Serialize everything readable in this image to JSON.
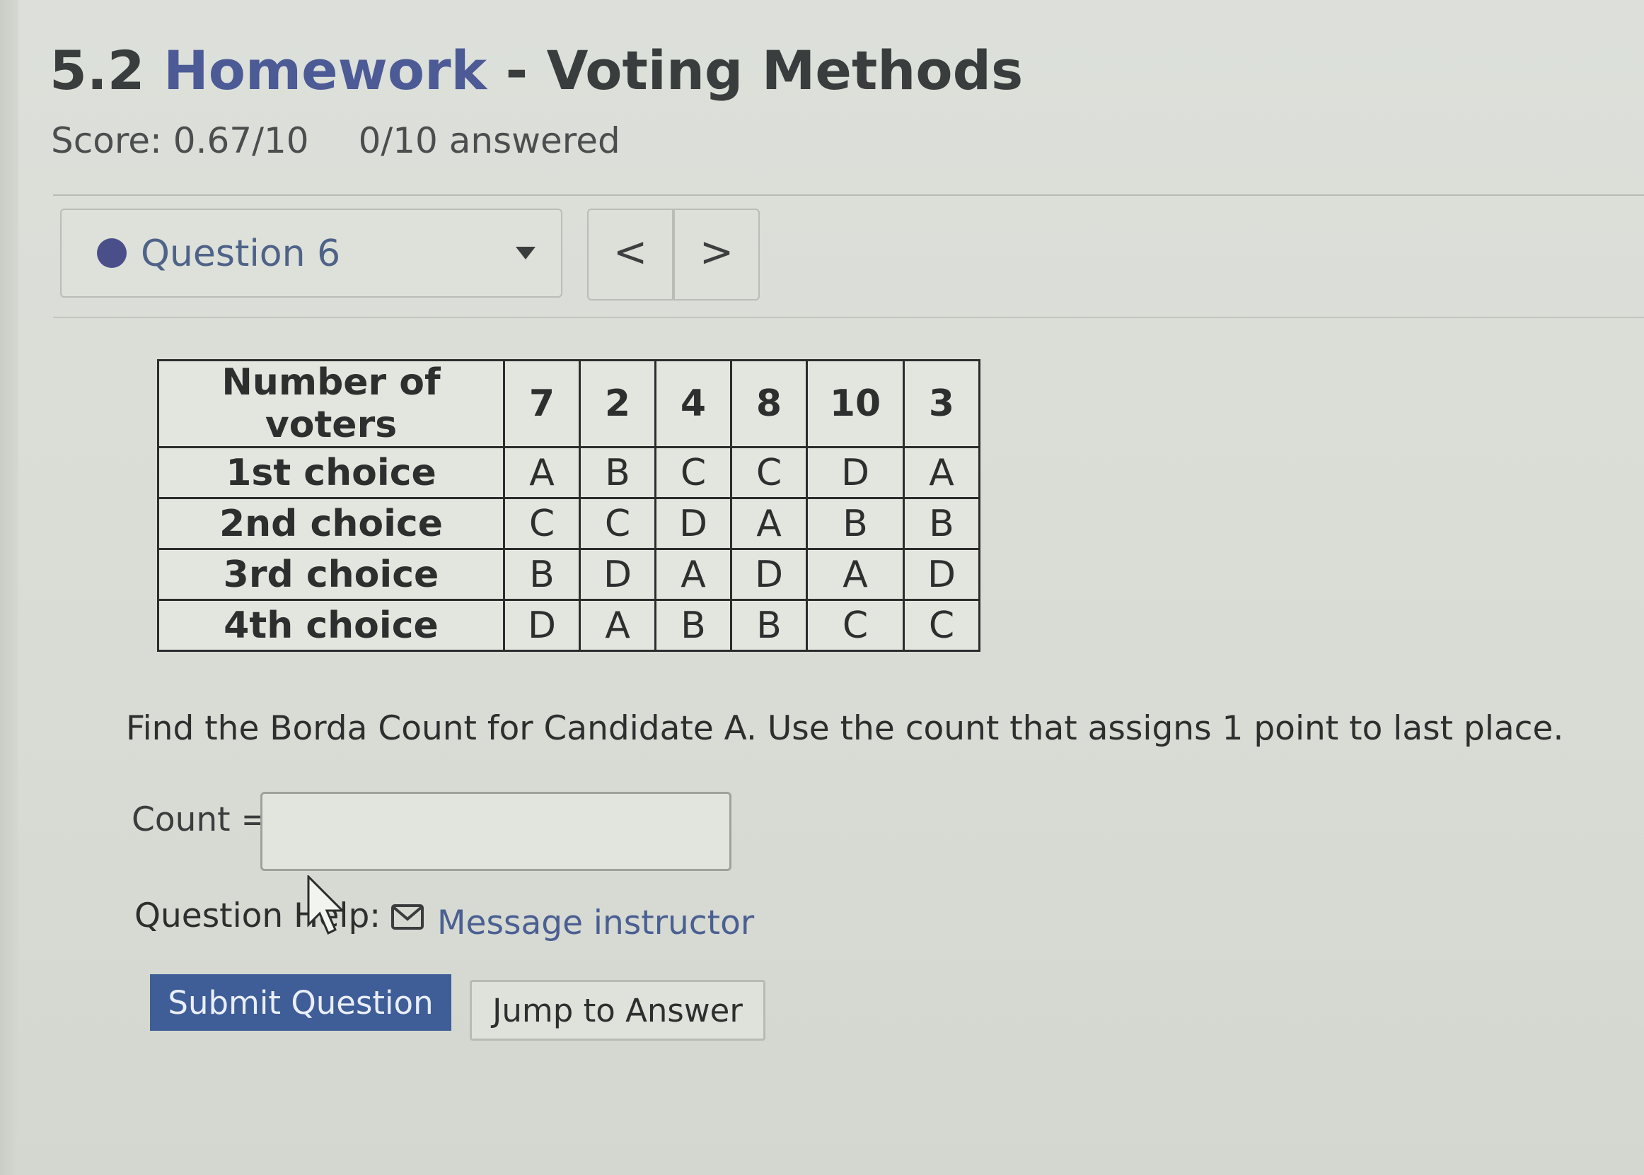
{
  "header": {
    "title_prefix": "5.2 ",
    "title_blue": "Homework",
    "title_rest": " - Voting Methods",
    "score": "Score: 0.67/10",
    "answered": "0/10 answered"
  },
  "question_nav": {
    "selected_question": "Question 6",
    "prev_label": "<",
    "next_label": ">"
  },
  "preference_table": {
    "row_label_header": "Number of voters",
    "voter_counts": [
      "7",
      "2",
      "4",
      "8",
      "10",
      "3"
    ],
    "rows": [
      {
        "label": "1st choice",
        "values": [
          "A",
          "B",
          "C",
          "C",
          "D",
          "A"
        ]
      },
      {
        "label": "2nd choice",
        "values": [
          "C",
          "C",
          "D",
          "A",
          "B",
          "B"
        ]
      },
      {
        "label": "3rd choice",
        "values": [
          "B",
          "D",
          "A",
          "D",
          "A",
          "D"
        ]
      },
      {
        "label": "4th choice",
        "values": [
          "D",
          "A",
          "B",
          "B",
          "C",
          "C"
        ]
      }
    ]
  },
  "question": {
    "prompt": "Find the Borda Count for Candidate A. Use the count that assigns 1 point to last place.",
    "count_label": "Count =",
    "count_value": ""
  },
  "help": {
    "label": "Question Help:",
    "message_link": "Message instructor"
  },
  "actions": {
    "submit_label": "Submit Question",
    "jump_label": "Jump to Answer"
  },
  "colors": {
    "accent_blue": "#3f5d97",
    "link_blue": "#4a5f92",
    "status_dot": "#4a4f8a"
  }
}
